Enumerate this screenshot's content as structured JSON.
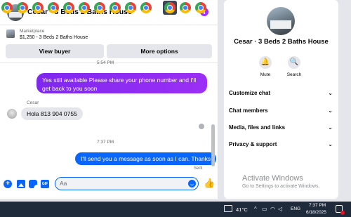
{
  "chat": {
    "title": "Cesar · 3 Beds 2 Baths House",
    "marketplace_label": "Marketplace",
    "listing": "$1,250 - 3 Beds 2 Baths House",
    "view_buyer_label": "View buyer",
    "more_options_label": "More options",
    "messages": {
      "time_1": "5:54 PM",
      "outgoing_1": "Yes still available Please share your phone number and I'll get back to you soon",
      "sender_name": "Cesar",
      "incoming_1": "Hola 813 904 0755",
      "time_2": "7:37 PM",
      "outgoing_2": "I'll send you a message as soon as I can. Thanks",
      "status": "Sent"
    },
    "composer": {
      "placeholder": "Aa",
      "icons": [
        "plus-icon",
        "photo-icon",
        "sticker-icon",
        "gif-icon",
        "emoji-icon",
        "like-icon"
      ],
      "accent_color": "#0866ff"
    },
    "outgoing_color": "#7b2ff7"
  },
  "details": {
    "title": "Cesar · 3 Beds 2 Baths House",
    "mute_label": "Mute",
    "search_label": "Search",
    "menu": [
      {
        "label": "Customize chat"
      },
      {
        "label": "Chat members"
      },
      {
        "label": "Media, files and links"
      },
      {
        "label": "Privacy & support"
      }
    ],
    "watermark_title": "Activate Windows",
    "watermark_subtitle": "Go to Settings to activate Windows."
  },
  "taskbar": {
    "app_icons": "chrome-icon",
    "weather": "41°C",
    "language": "ENG",
    "time": "7:37 PM",
    "date": "6/18/2025"
  }
}
